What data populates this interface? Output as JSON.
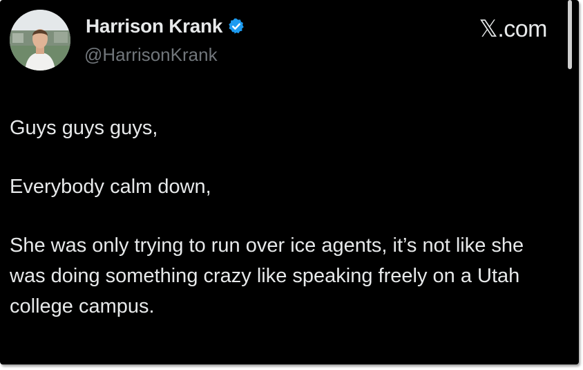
{
  "post": {
    "author": {
      "display_name": "Harrison Krank",
      "handle": "@HarrisonKrank",
      "verified": true,
      "verified_icon": "verified-badge-icon",
      "avatar_icon": "profile-photo"
    },
    "source_label": "𝕏.com",
    "paragraphs": [
      "Guys guys guys,",
      "Everybody calm down,",
      "She was only trying to run over ice agents, it’s not like she was doing something crazy like speaking freely on a Utah college campus."
    ]
  },
  "colors": {
    "background": "#000000",
    "text_primary": "#e7e9ea",
    "text_secondary": "#71767b",
    "verified_blue": "#1d9bf0"
  }
}
